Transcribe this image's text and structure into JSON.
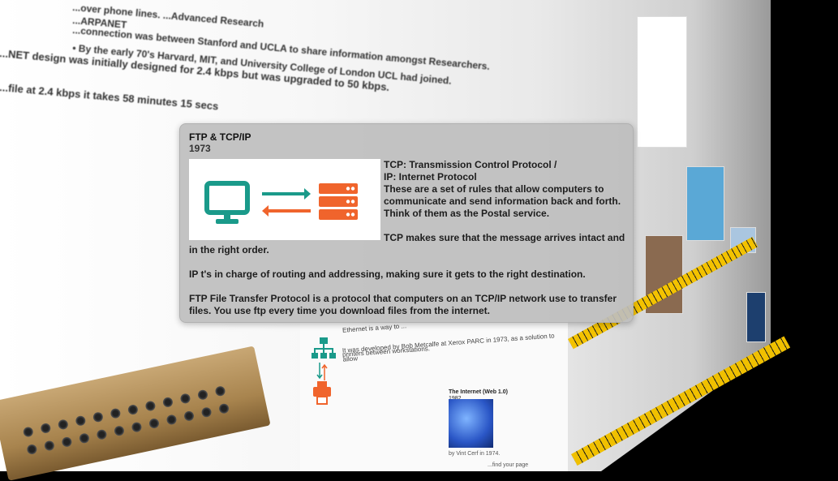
{
  "background_text": {
    "line1": "...over phone lines. ...Advanced Research",
    "line2": "...ARPANET",
    "line3": "...connection was between Stanford and UCLA to share information amongst Researchers.",
    "line4": "• By the early 70's Harvard, MIT, and University College of London UCL had joined.",
    "line5": "...NET design was initially designed for 2.4 kbps but was upgraded to 50 kbps.",
    "line6": "...file at 2.4 kbps it takes 58 minutes 15 secs"
  },
  "popup": {
    "title": "FTP & TCP/IP",
    "year": "1973",
    "text_line1": "TCP: Transmission Control Protocol /",
    "text_line2": "IP: Internet Protocol",
    "text_body": "These are a set of rules that allow computers to communicate and send information back and forth. Think of them as the Postal service.",
    "tcp_para_a": "TCP makes sure that the message arrives intact and",
    "tcp_para_b": "in the right order.",
    "ip_para": "IP t's in charge of routing and addressing, making sure it gets to the right destination.",
    "ftp_para": "FTP File Transfer Protocol is a protocol that computers on an TCP/IP network use to transfer files. You use ftp every time you download files from the internet.",
    "icon_colors": {
      "monitor": "#1a9a8a",
      "arrow_right": "#1a9a8a",
      "arrow_left": "#f0642c",
      "server": "#f0642c"
    }
  },
  "lower_panel": {
    "eth_line1": "Ethernet is a way to ...",
    "eth_line2": "It was developed by Bob Metcalfe at Xerox PARC in 1973, as a solution to allow",
    "eth_line3": "printers between workstations.",
    "internet_title": "The Internet (Web 1.0)",
    "internet_year": "1982",
    "internet_credit": "by Vint Cerf in 1974.",
    "internet_footer": "...find your page"
  }
}
